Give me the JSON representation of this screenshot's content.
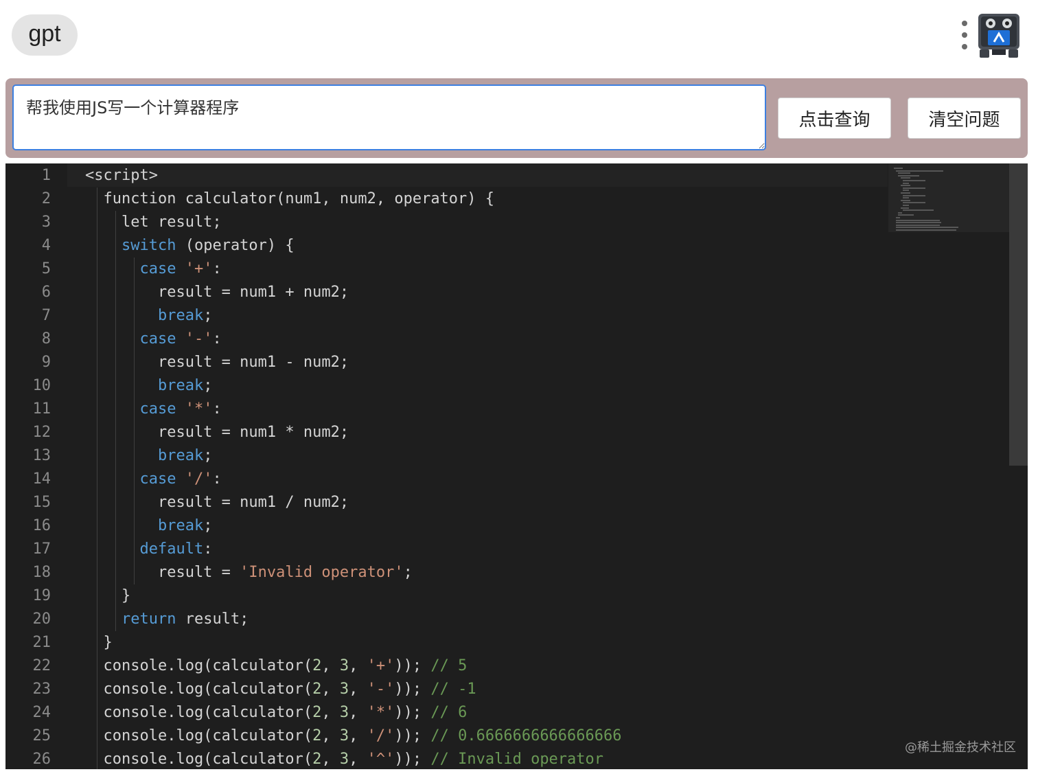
{
  "header": {
    "app_name": "gpt",
    "menu_icon": "kebab-menu-icon",
    "avatar_icon": "robot-avatar-icon"
  },
  "query": {
    "input_value": "帮我使用JS写一个计算器程序",
    "submit_label": "点击查询",
    "clear_label": "清空问题"
  },
  "editor": {
    "lines": [
      [
        [
          "<script>",
          "p"
        ]
      ],
      [
        [
          "  function calculator(num1, num2, operator) {",
          "p"
        ]
      ],
      [
        [
          "    let result;",
          "p"
        ]
      ],
      [
        [
          "    ",
          "p"
        ],
        [
          "switch",
          "kw"
        ],
        [
          " (operator) {",
          "p"
        ]
      ],
      [
        [
          "      ",
          "p"
        ],
        [
          "case",
          "kw"
        ],
        [
          " ",
          "p"
        ],
        [
          "'+'",
          "str"
        ],
        [
          ":",
          "p"
        ]
      ],
      [
        [
          "        result = num1 + num2;",
          "p"
        ]
      ],
      [
        [
          "        ",
          "p"
        ],
        [
          "break",
          "kw"
        ],
        [
          ";",
          "p"
        ]
      ],
      [
        [
          "      ",
          "p"
        ],
        [
          "case",
          "kw"
        ],
        [
          " ",
          "p"
        ],
        [
          "'-'",
          "str"
        ],
        [
          ":",
          "p"
        ]
      ],
      [
        [
          "        result = num1 - num2;",
          "p"
        ]
      ],
      [
        [
          "        ",
          "p"
        ],
        [
          "break",
          "kw"
        ],
        [
          ";",
          "p"
        ]
      ],
      [
        [
          "      ",
          "p"
        ],
        [
          "case",
          "kw"
        ],
        [
          " ",
          "p"
        ],
        [
          "'*'",
          "str"
        ],
        [
          ":",
          "p"
        ]
      ],
      [
        [
          "        result = num1 * num2;",
          "p"
        ]
      ],
      [
        [
          "        ",
          "p"
        ],
        [
          "break",
          "kw"
        ],
        [
          ";",
          "p"
        ]
      ],
      [
        [
          "      ",
          "p"
        ],
        [
          "case",
          "kw"
        ],
        [
          " ",
          "p"
        ],
        [
          "'/'",
          "str"
        ],
        [
          ":",
          "p"
        ]
      ],
      [
        [
          "        result = num1 / num2;",
          "p"
        ]
      ],
      [
        [
          "        ",
          "p"
        ],
        [
          "break",
          "kw"
        ],
        [
          ";",
          "p"
        ]
      ],
      [
        [
          "      ",
          "p"
        ],
        [
          "default",
          "kw"
        ],
        [
          ":",
          "p"
        ]
      ],
      [
        [
          "        result = ",
          "p"
        ],
        [
          "'Invalid operator'",
          "str"
        ],
        [
          ";",
          "p"
        ]
      ],
      [
        [
          "    }",
          "p"
        ]
      ],
      [
        [
          "    ",
          "p"
        ],
        [
          "return",
          "kw"
        ],
        [
          " result;",
          "p"
        ]
      ],
      [
        [
          "  }",
          "p"
        ]
      ],
      [
        [
          "  console.log(calculator(",
          "p"
        ],
        [
          "2",
          "num"
        ],
        [
          ", ",
          "p"
        ],
        [
          "3",
          "num"
        ],
        [
          ", ",
          "p"
        ],
        [
          "'+'",
          "str"
        ],
        [
          ")); ",
          "p"
        ],
        [
          "// 5",
          "cmt"
        ]
      ],
      [
        [
          "  console.log(calculator(",
          "p"
        ],
        [
          "2",
          "num"
        ],
        [
          ", ",
          "p"
        ],
        [
          "3",
          "num"
        ],
        [
          ", ",
          "p"
        ],
        [
          "'-'",
          "str"
        ],
        [
          ")); ",
          "p"
        ],
        [
          "// -1",
          "cmt"
        ]
      ],
      [
        [
          "  console.log(calculator(",
          "p"
        ],
        [
          "2",
          "num"
        ],
        [
          ", ",
          "p"
        ],
        [
          "3",
          "num"
        ],
        [
          ", ",
          "p"
        ],
        [
          "'*'",
          "str"
        ],
        [
          ")); ",
          "p"
        ],
        [
          "// 6",
          "cmt"
        ]
      ],
      [
        [
          "  console.log(calculator(",
          "p"
        ],
        [
          "2",
          "num"
        ],
        [
          ", ",
          "p"
        ],
        [
          "3",
          "num"
        ],
        [
          ", ",
          "p"
        ],
        [
          "'/'",
          "str"
        ],
        [
          ")); ",
          "p"
        ],
        [
          "// 0.6666666666666666",
          "cmt"
        ]
      ],
      [
        [
          "  console.log(calculator(",
          "p"
        ],
        [
          "2",
          "num"
        ],
        [
          ", ",
          "p"
        ],
        [
          "3",
          "num"
        ],
        [
          ", ",
          "p"
        ],
        [
          "'^'",
          "str"
        ],
        [
          ")); ",
          "p"
        ],
        [
          "// Invalid operator",
          "cmt"
        ]
      ]
    ]
  },
  "watermark": "@稀土掘金技术社区",
  "colors": {
    "accent_bar": "#b79fa0",
    "input_border": "#3c7fe0",
    "editor_bg": "#1e1e1e",
    "keyword": "#569cd6",
    "string": "#ce9178",
    "number": "#b5cea8",
    "comment": "#6a9955"
  }
}
